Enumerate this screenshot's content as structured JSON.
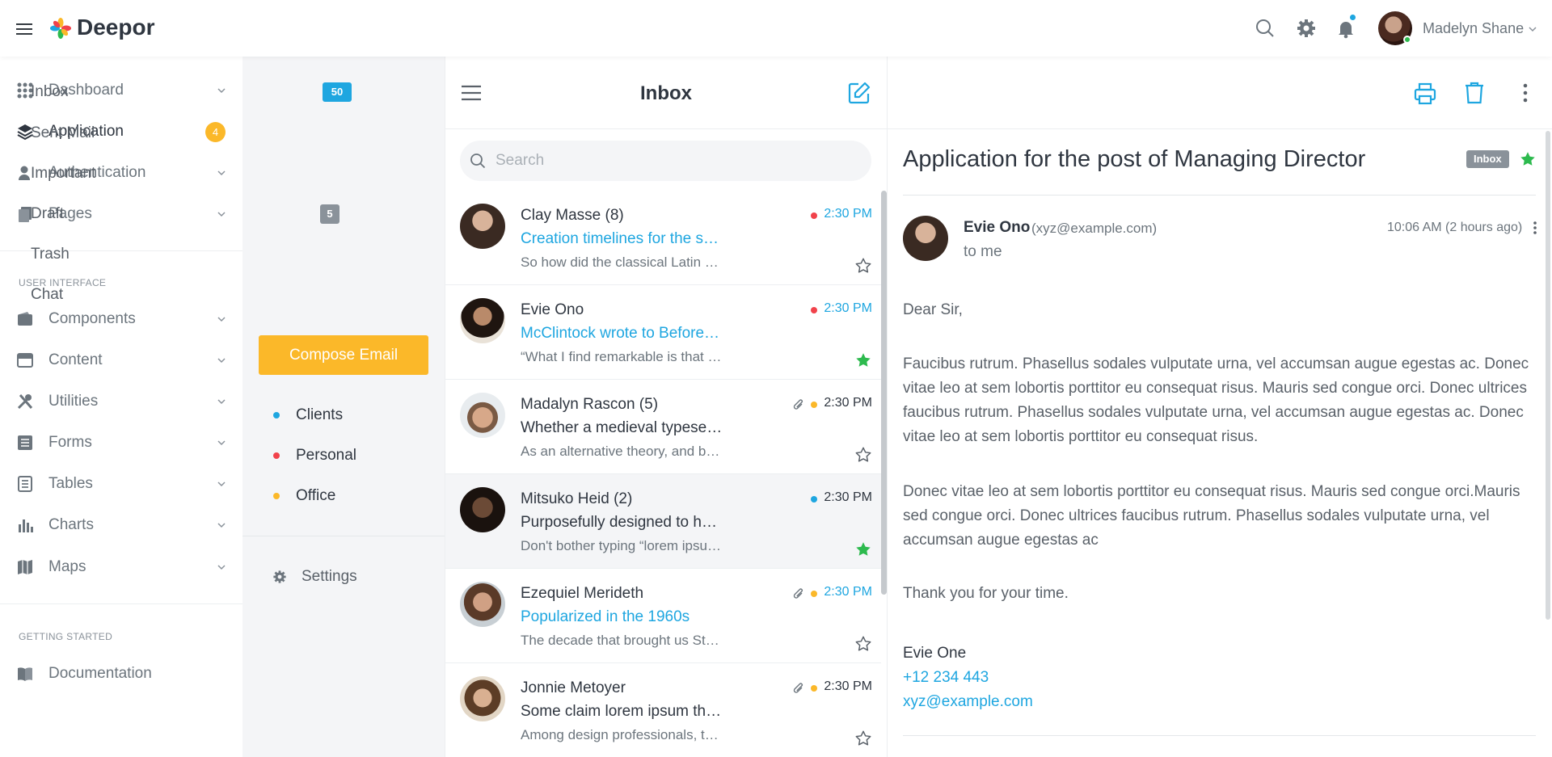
{
  "app": {
    "brand": "Deepor"
  },
  "topbar": {
    "user_name": "Madelyn Shane"
  },
  "sidebar": {
    "items": [
      {
        "label": "Dashboard",
        "icon": "grid-icon"
      },
      {
        "label": "Application",
        "icon": "layers-icon",
        "badge": "4"
      },
      {
        "label": "Authentication",
        "icon": "user-icon"
      },
      {
        "label": "Pages",
        "icon": "pages-icon"
      }
    ],
    "section_ui": "USER INTERFACE",
    "ui_items": [
      {
        "label": "Components",
        "icon": "wallet-icon"
      },
      {
        "label": "Content",
        "icon": "card-icon"
      },
      {
        "label": "Utilities",
        "icon": "tools-icon"
      },
      {
        "label": "Forms",
        "icon": "form-icon"
      },
      {
        "label": "Tables",
        "icon": "table-icon"
      },
      {
        "label": "Charts",
        "icon": "chart-icon"
      },
      {
        "label": "Maps",
        "icon": "map-icon"
      }
    ],
    "section_start": "GETTING STARTED",
    "doc_label": "Documentation"
  },
  "folders": {
    "items": [
      {
        "label": "Inbox",
        "badge": "50"
      },
      {
        "label": "Sent Mail"
      },
      {
        "label": "Important"
      },
      {
        "label": "Draft",
        "badge": "5"
      },
      {
        "label": "Trash"
      },
      {
        "label": "Chat"
      }
    ],
    "compose": "Compose Email",
    "labels": [
      {
        "label": "Clients",
        "color": "#1ea6e0"
      },
      {
        "label": "Personal",
        "color": "#f1424b"
      },
      {
        "label": "Office",
        "color": "#fbb829"
      }
    ],
    "settings": "Settings"
  },
  "list": {
    "title": "Inbox",
    "search_placeholder": "Search",
    "messages": [
      {
        "from": "Clay Masse (8)",
        "subject": "Creation timelines for the standard lorem ipsum",
        "snippet": "So how did the classical Latin become so incoherent?",
        "time": "2:30 PM",
        "dot": "#f1424b",
        "starred": false,
        "attachment": false
      },
      {
        "from": "Evie Ono",
        "subject": "McClintock wrote to Before & After",
        "snippet": "“What I find remarkable is that this text has been the industry's standard",
        "time": "2:30 PM",
        "dot": "#f1424b",
        "starred": true,
        "attachment": false
      },
      {
        "from": "Madalyn Rascon (5)",
        "subject": "Whether a medieval typesetter chose to garble",
        "snippet": "As an alternative theory, and because Latin scholars",
        "time": "2:30 PM",
        "dot": "#fbb829",
        "starred": false,
        "attachment": true
      },
      {
        "from": "Mitsuko Heid (2)",
        "subject": "Purposefully designed to have no meaning",
        "snippet": "Don't bother typing “lorem ipsum” into Google translate",
        "time": "2:30 PM",
        "dot": "#1ea6e0",
        "starred": true,
        "attachment": false
      },
      {
        "from": "Ezequiel Merideth",
        "subject": "Popularized in the 1960s",
        "snippet": "The decade that brought us Star Trek and Woodstock",
        "time": "2:30 PM",
        "dot": "#fbb829",
        "starred": false,
        "attachment": true
      },
      {
        "from": "Jonnie Metoyer",
        "subject": "Some claim lorem ipsum threatens to promote design",
        "snippet": "Among design professionals, there's a bit of controversy",
        "time": "2:30 PM",
        "dot": "#fbb829",
        "starred": false,
        "attachment": true
      }
    ]
  },
  "reader": {
    "title": "Application for the post of Managing Director",
    "tag": "Inbox",
    "from_name": "Evie Ono",
    "from_email": "(xyz@example.com)",
    "to": "to me",
    "date": "10:06 AM (2 hours ago)",
    "greeting": "Dear Sir,",
    "para1": "Faucibus rutrum. Phasellus sodales vulputate urna, vel accumsan augue egestas ac. Donec vitae leo at sem lobortis porttitor eu consequat risus. Mauris sed congue orci. Donec ultrices faucibus rutrum. Phasellus sodales vulputate urna, vel accumsan augue egestas ac. Donec vitae leo at sem lobortis porttitor eu consequat risus.",
    "para2": "Donec vitae leo at sem lobortis porttitor eu consequat risus. Mauris sed congue orci.Mauris sed congue orci. Donec ultrices faucibus rutrum. Phasellus sodales vulputate urna, vel accumsan augue egestas ac",
    "closing": "Thank you for your time.",
    "sign_name": "Evie One",
    "sign_phone": "+12 234 443",
    "sign_email": "xyz@example.com"
  },
  "colors": {
    "accent": "#1ea6e0",
    "warning": "#fbb829",
    "danger": "#f1424b",
    "success": "#2dba4e"
  }
}
